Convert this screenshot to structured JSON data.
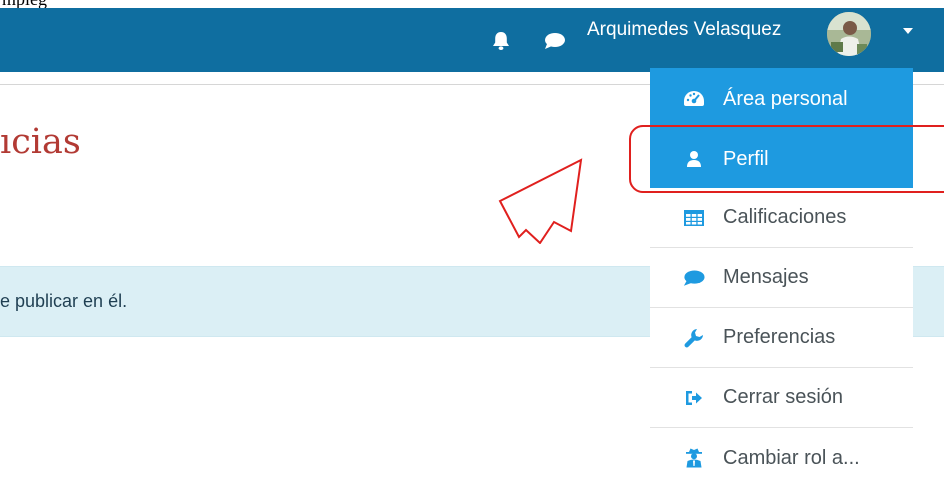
{
  "caption": {
    "text": "mpleg"
  },
  "navbar": {
    "user_name": "Arquimedes Velasquez",
    "icons": [
      "bell-icon",
      "chat-bubble-icon",
      "chevron-down-icon"
    ],
    "bg_color": "#0f6ea0"
  },
  "page": {
    "heading": "ıcias",
    "heading_color": "#b23a34",
    "info_text": "e publicar en él."
  },
  "user_menu": {
    "items": [
      {
        "label": "Área personal",
        "icon": "dashboard-icon",
        "highlighted": true
      },
      {
        "label": "Perfil",
        "icon": "user-icon",
        "highlighted": true
      },
      {
        "label": "Calificaciones",
        "icon": "table-icon",
        "highlighted": false
      },
      {
        "label": "Mensajes",
        "icon": "chat-bubble-icon",
        "highlighted": false
      },
      {
        "label": "Preferencias",
        "icon": "wrench-icon",
        "highlighted": false
      },
      {
        "label": "Cerrar sesión",
        "icon": "sign-out-icon",
        "highlighted": false
      },
      {
        "label": "Cambiar rol a...",
        "icon": "user-secret-icon",
        "highlighted": false
      }
    ],
    "highlight_color": "#1e9ae0"
  },
  "annotation": {
    "callout_color": "#e0201e",
    "target": "Perfil"
  }
}
